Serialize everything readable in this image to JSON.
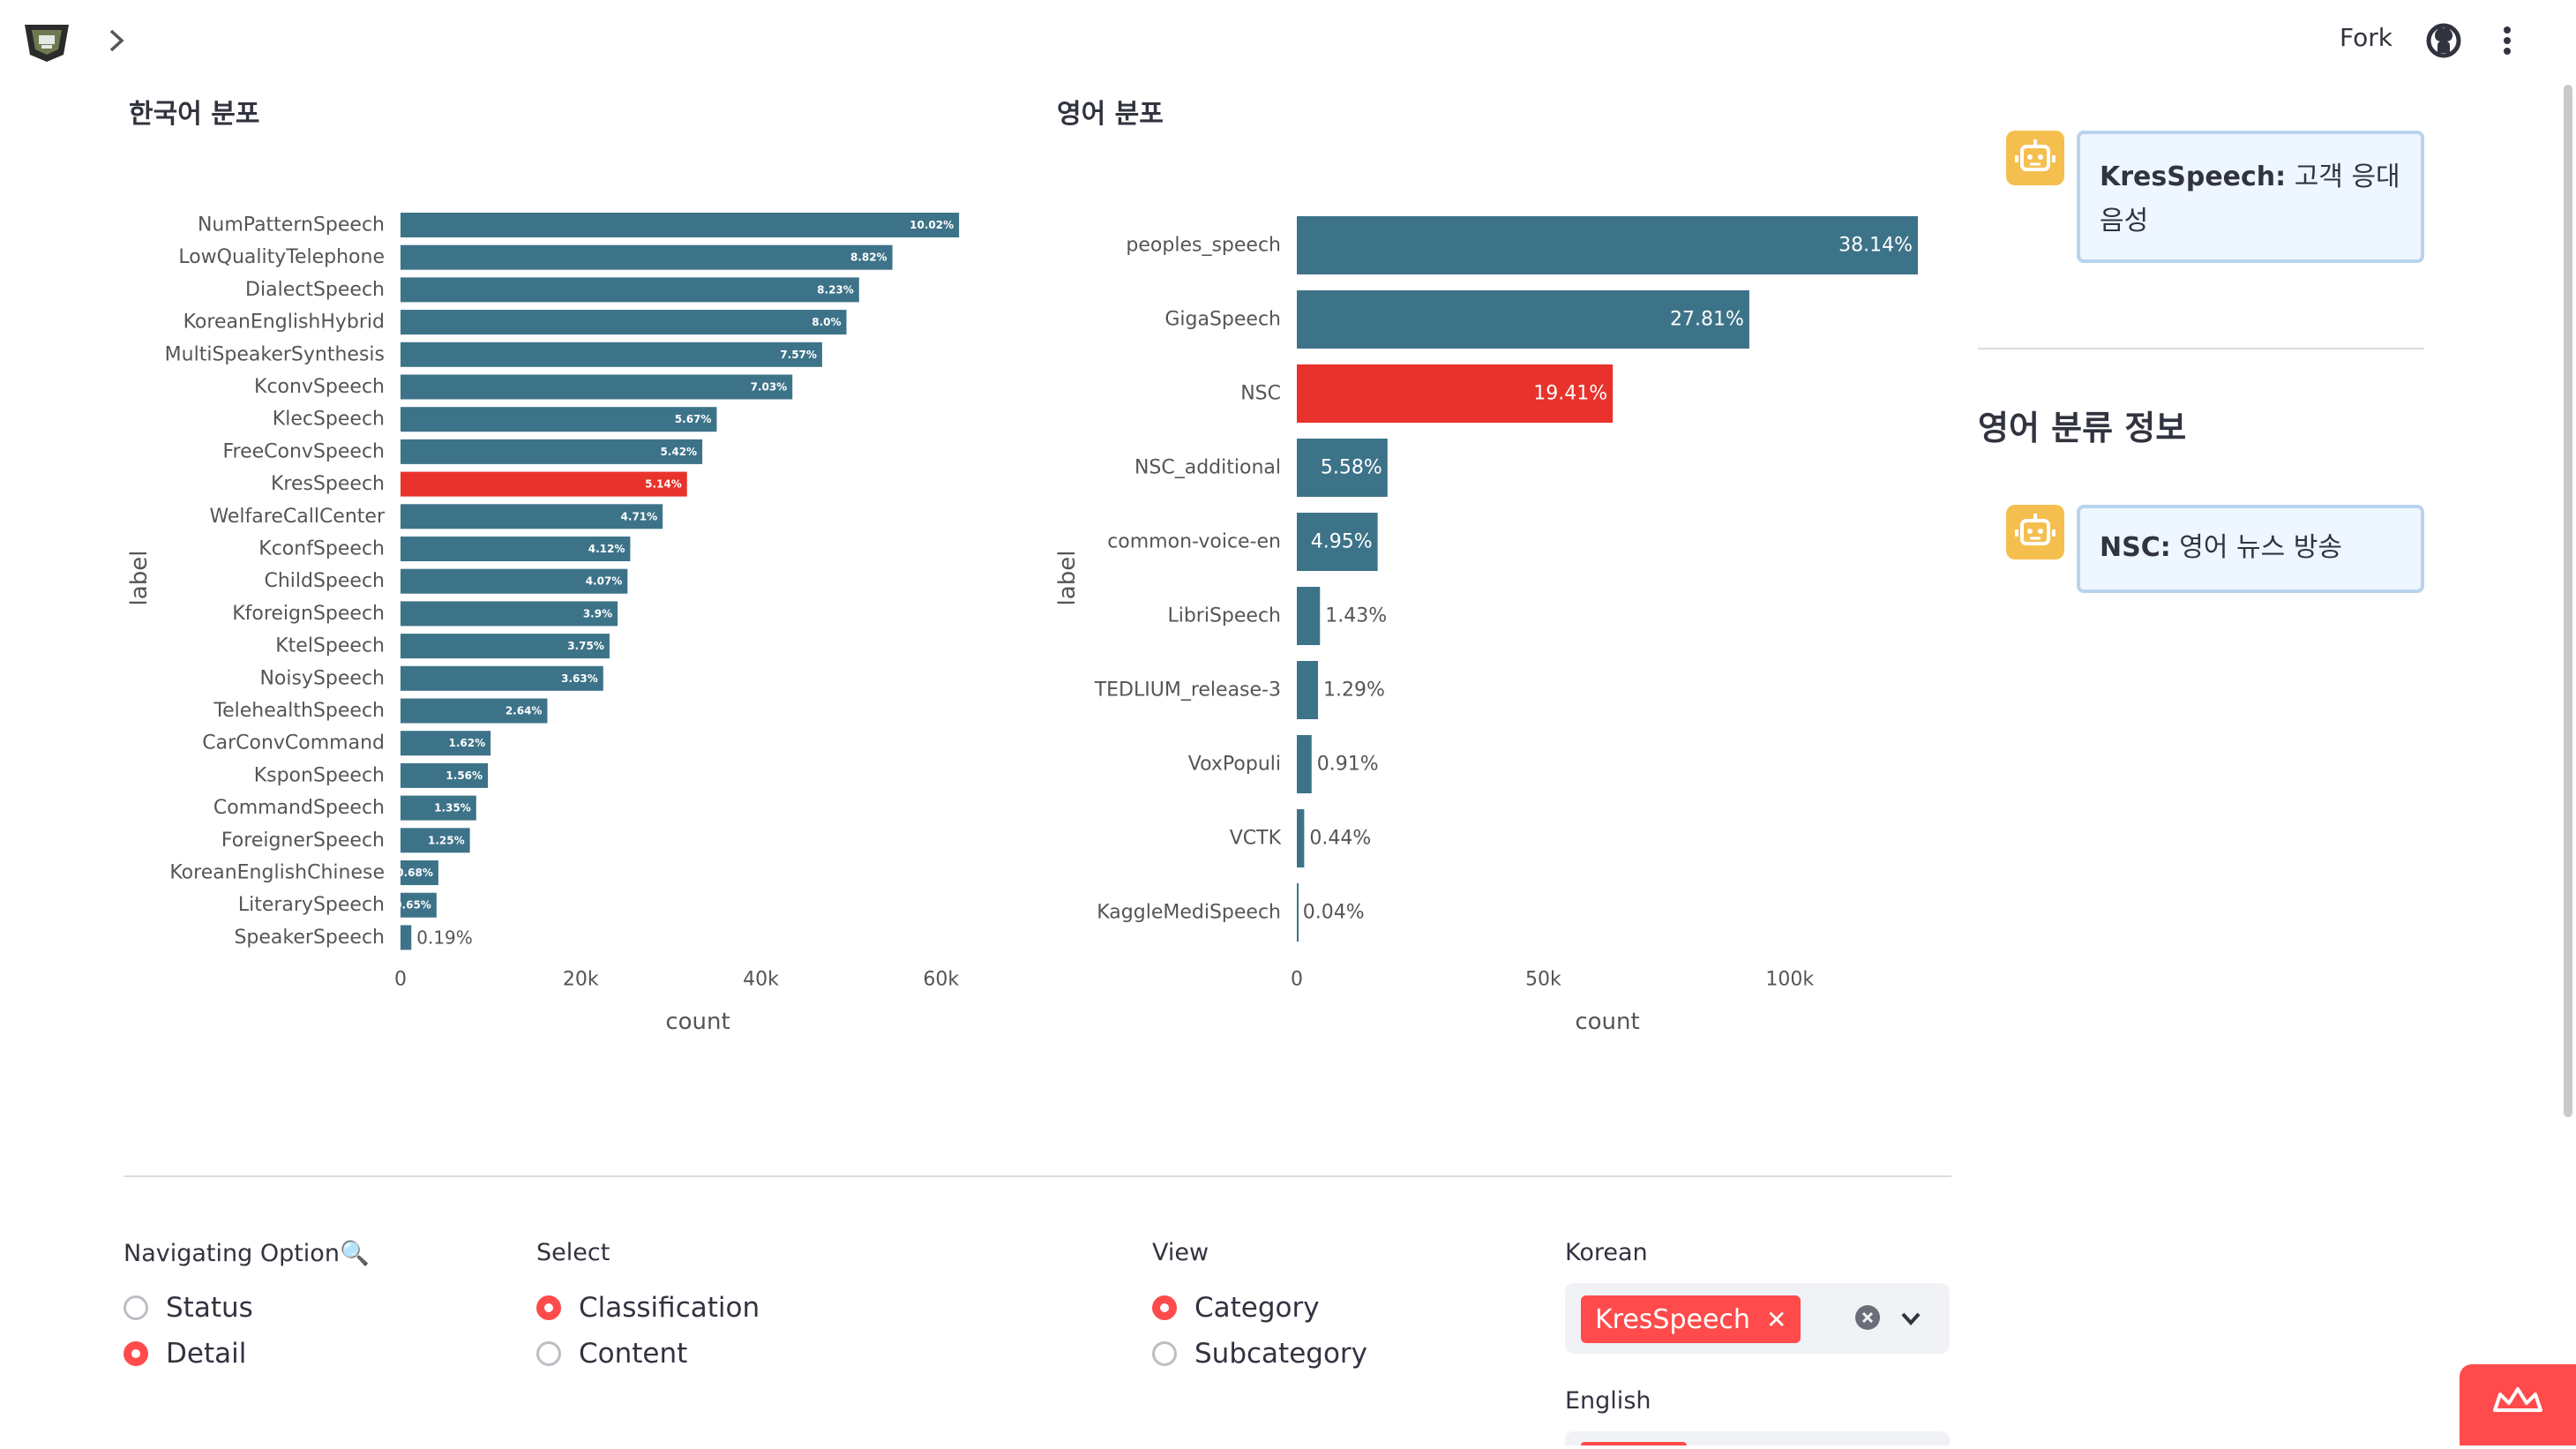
{
  "header": {
    "fork_label": "Fork"
  },
  "ko_chart_title": "한국어 분포",
  "en_chart_title": "영어 분포",
  "chart_data": [
    {
      "type": "bar",
      "orientation": "horizontal",
      "title": "한국어 분포",
      "xlabel": "count",
      "ylabel": "label",
      "xticks": [
        "0",
        "20k",
        "40k",
        "60k"
      ],
      "xlim": [
        0,
        66000
      ],
      "categories": [
        "NumPatternSpeech",
        "LowQualityTelephone",
        "DialectSpeech",
        "KoreanEnglishHybrid",
        "MultiSpeakerSynthesis",
        "KconvSpeech",
        "KlecSpeech",
        "FreeConvSpeech",
        "KresSpeech",
        "WelfareCallCenter",
        "KconfSpeech",
        "ChildSpeech",
        "KforeignSpeech",
        "KtelSpeech",
        "NoisySpeech",
        "TelehealthSpeech",
        "CarConvCommand",
        "KsponSpeech",
        "CommandSpeech",
        "ForeignerSpeech",
        "KoreanEnglishChinese",
        "LiterarySpeech",
        "SpeakerSpeech"
      ],
      "values": [
        62000,
        54600,
        50900,
        49500,
        46800,
        43500,
        35100,
        33500,
        31800,
        29100,
        25500,
        25200,
        24100,
        23200,
        22500,
        16300,
        10000,
        9700,
        8400,
        7700,
        4200,
        4000,
        1200
      ],
      "labels": [
        "10.02%",
        "8.82%",
        "8.23%",
        "8.0%",
        "7.57%",
        "7.03%",
        "5.67%",
        "5.42%",
        "5.14%",
        "4.71%",
        "4.12%",
        "4.07%",
        "3.9%",
        "3.75%",
        "3.63%",
        "2.64%",
        "1.62%",
        "1.56%",
        "1.35%",
        "1.25%",
        "0.68%",
        "0.65%",
        "0.19%"
      ],
      "highlight": "KresSpeech",
      "colors": {
        "bar": "#3d7389",
        "highlight": "#e8322b"
      }
    },
    {
      "type": "bar",
      "orientation": "horizontal",
      "title": "영어 분포",
      "xlabel": "count",
      "ylabel": "label",
      "xticks": [
        "0",
        "50k",
        "100k"
      ],
      "xlim": [
        0,
        126000
      ],
      "categories": [
        "peoples_speech",
        "GigaSpeech",
        "NSC",
        "NSC_additional",
        "common-voice-en",
        "LibriSpeech",
        "TEDLIUM_release-3",
        "VoxPopuli",
        "VCTK",
        "KaggleMediSpeech"
      ],
      "values": [
        126000,
        91800,
        64100,
        18400,
        16400,
        4700,
        4300,
        3000,
        1500,
        130
      ],
      "labels": [
        "38.14%",
        "27.81%",
        "19.41%",
        "5.58%",
        "4.95%",
        "1.43%",
        "1.29%",
        "0.91%",
        "0.44%",
        "0.04%"
      ],
      "highlight": "NSC",
      "colors": {
        "bar": "#3d7389",
        "highlight": "#e8322b"
      }
    }
  ],
  "info": {
    "ko_message_name": "KresSpeech:",
    "ko_message_text": " 고객 응대 음성",
    "en_heading": "영어 분류 정보",
    "en_message_name": "NSC:",
    "en_message_text": " 영어 뉴스 방송"
  },
  "controls": {
    "nav_label": "Navigating Option🔍",
    "nav_options": [
      "Status",
      "Detail"
    ],
    "nav_selected": "Detail",
    "select_label": "Select",
    "select_options": [
      "Classification",
      "Content"
    ],
    "select_selected": "Classification",
    "view_label": "View",
    "view_options": [
      "Category",
      "Subcategory"
    ],
    "view_selected": "Category",
    "korean_label": "Korean",
    "korean_tag": "KresSpeech",
    "english_label": "English"
  }
}
